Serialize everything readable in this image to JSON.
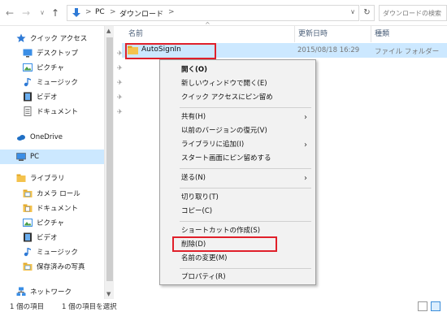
{
  "nav": {
    "back_glyph": "←",
    "forward_glyph": "→",
    "history_glyph": "∨",
    "up_glyph": "↑"
  },
  "address": {
    "crumbs": [
      "PC",
      "ダウンロード"
    ],
    "separator": ">",
    "dropdown_glyph": "∨",
    "refresh_glyph": "↻"
  },
  "search": {
    "placeholder": "ダウンロードの検索"
  },
  "sidebar": {
    "quick_access": "クイック アクセス",
    "desktop": "デスクトップ",
    "pictures": "ピクチャ",
    "music": "ミュージック",
    "videos": "ビデオ",
    "documents": "ドキュメント",
    "onedrive": "OneDrive",
    "pc": "PC",
    "libraries": "ライブラリ",
    "camera_roll": "カメラ ロール",
    "lib_documents": "ドキュメント",
    "lib_pictures": "ピクチャ",
    "lib_videos": "ビデオ",
    "lib_music": "ミュージック",
    "saved_pictures": "保存済みの写真",
    "network": "ネットワーク",
    "pin_glyph": "✈"
  },
  "columns": {
    "name": "名前",
    "date": "更新日時",
    "type": "種類",
    "sort_glyph": "^"
  },
  "file": {
    "name": "AutoSignIn",
    "date": "2015/08/18 16:29",
    "type": "ファイル フォルダー"
  },
  "context_menu": {
    "open": "開く(O)",
    "open_new_window": "新しいウィンドウで開く(E)",
    "pin_quick_access": "クイック アクセスにピン留め",
    "share": "共有(H)",
    "restore_previous": "以前のバージョンの復元(V)",
    "add_to_library": "ライブラリに追加(I)",
    "pin_start": "スタート画面にピン留めする",
    "send_to": "送る(N)",
    "cut": "切り取り(T)",
    "copy": "コピー(C)",
    "create_shortcut": "ショートカットの作成(S)",
    "delete": "削除(D)",
    "rename": "名前の変更(M)",
    "properties": "プロパティ(R)",
    "submenu_glyph": "›"
  },
  "status": {
    "items": "1 個の項目",
    "selected": "1 個の項目を選択"
  },
  "colors": {
    "selection": "#cce8ff",
    "highlight_box": "#e0202a",
    "header_text": "#4c607a"
  }
}
